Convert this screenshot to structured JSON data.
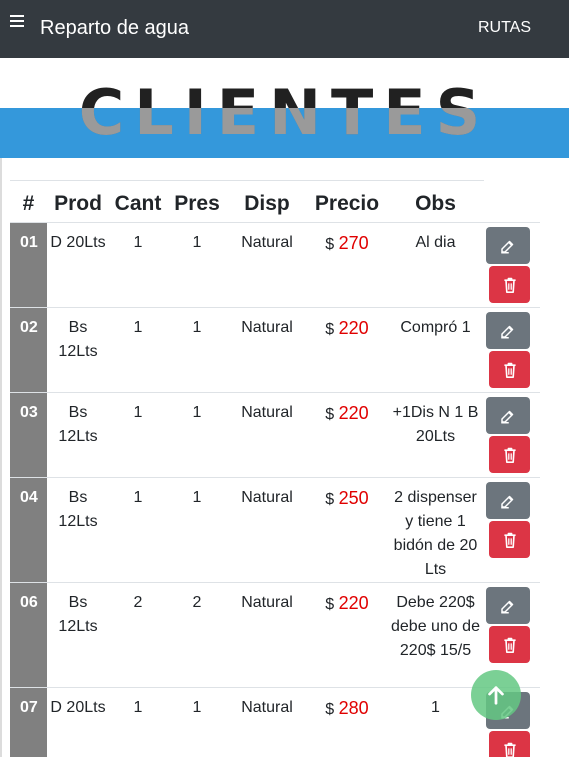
{
  "navbar": {
    "brand": "Reparto de agua",
    "link": "RUTAS",
    "menu_icon": "hamburger-icon"
  },
  "banner": {
    "title": "CLIENTES"
  },
  "table": {
    "headers": [
      "#",
      "Prod",
      "Cant",
      "Pres",
      "Disp",
      "Precio",
      "Obs"
    ],
    "currency": "$",
    "rows": [
      {
        "num": "01",
        "prod": "D 20Lts",
        "cant": "1",
        "pres": "1",
        "disp": "Natural",
        "precio": "270",
        "obs": "Al dia"
      },
      {
        "num": "02",
        "prod": "Bs 12Lts",
        "cant": "1",
        "pres": "1",
        "disp": "Natural",
        "precio": "220",
        "obs": "Compró 1"
      },
      {
        "num": "03",
        "prod": "Bs 12Lts",
        "cant": "1",
        "pres": "1",
        "disp": "Natural",
        "precio": "220",
        "obs": "+1Dis N 1 B 20Lts"
      },
      {
        "num": "04",
        "prod": "Bs 12Lts",
        "cant": "1",
        "pres": "1",
        "disp": "Natural",
        "precio": "250",
        "obs": "2 dispenser y tiene 1 bidón de 20 Lts"
      },
      {
        "num": "06",
        "prod": "Bs 12Lts",
        "cant": "2",
        "pres": "2",
        "disp": "Natural",
        "precio": "220",
        "obs": "Debe 220$ debe uno de 220$ 15/5"
      },
      {
        "num": "07",
        "prod": "D 20Lts",
        "cant": "1",
        "pres": "1",
        "disp": "Natural",
        "precio": "280",
        "obs": "1"
      }
    ]
  },
  "icons": {
    "edit": "edit-icon",
    "delete": "trash-icon",
    "scroll_top": "arrow-up-icon"
  },
  "colors": {
    "navbar": "#343a40",
    "banner": "#3498db",
    "price": "#e00000",
    "edit_button": "#6c757d",
    "delete_button": "#dc3545",
    "row_number": "#808080",
    "fab": "#64c882"
  }
}
